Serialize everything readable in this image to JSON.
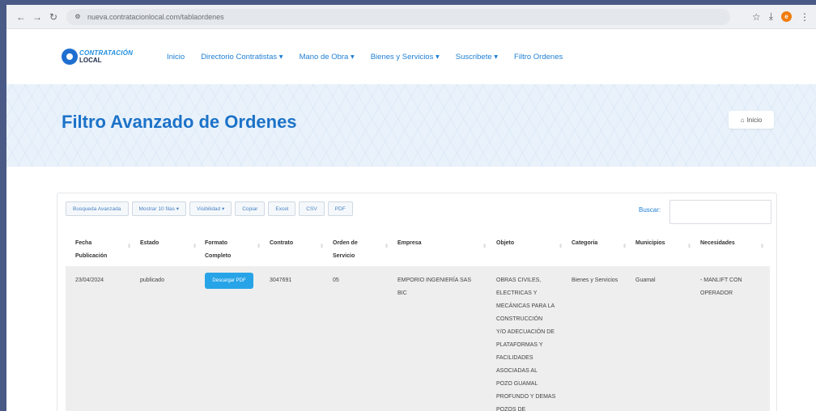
{
  "browser": {
    "url": "nueva.contratacionlocal.com/tablaordenes",
    "avatar_letter": "e"
  },
  "site": {
    "logo_line1": "CONTRATACIÓN",
    "logo_line2": "LOCAL",
    "nav": [
      "Inicio",
      "Directorio Contratistas ▾",
      "Mano de Obra ▾",
      "Bienes y Servicios ▾",
      "Suscribete ▾",
      "Filtro Ordenes"
    ]
  },
  "banner": {
    "title": "Filtro Avanzado de Ordenes",
    "home_label": "Inicio"
  },
  "toolbar": {
    "buttons": [
      "Busqueda Avanzada",
      "Mostrar 10 filas ▾",
      "Visibilidad ▾",
      "Copiar",
      "Excel",
      "CSV",
      "PDF"
    ],
    "search_label": "Buscar:"
  },
  "table": {
    "headers": {
      "fecha": [
        "Fecha",
        "Publicación"
      ],
      "estado": "Estado",
      "formato": [
        "Formato",
        "Completo"
      ],
      "contrato": "Contrato",
      "orden": [
        "Orden de",
        "Servicio"
      ],
      "empresa": "Empresa",
      "objeto": "Objeto",
      "categoria": "Categoria",
      "municipios": "Municipios",
      "necesidades": "Necesidades"
    },
    "row": {
      "fecha": "23/04/2024",
      "estado": "publicado",
      "pdf_button": "Descargar PDF",
      "contrato": "3047691",
      "orden": "05",
      "empresa": [
        "EMPORIO INGENIERÍA SAS",
        "BIC"
      ],
      "objeto": [
        "OBRAS CIVILES,",
        "ELECTRICAS Y",
        "MECÁNICAS PARA LA",
        "CONSTRUCCIÓN",
        "Y/O ADECUACIÓN DE",
        "PLATAFORMAS Y",
        "FACILIDADES",
        "ASOCIADAS AL",
        "POZO GUAMAL",
        "PROFUNDO Y DEMAS",
        "POZOS DE"
      ],
      "categoria": "Bienes y Servicios",
      "municipios": "Guamal",
      "necesidades": [
        "- MANLIFT CON",
        "OPERADOR"
      ]
    }
  }
}
